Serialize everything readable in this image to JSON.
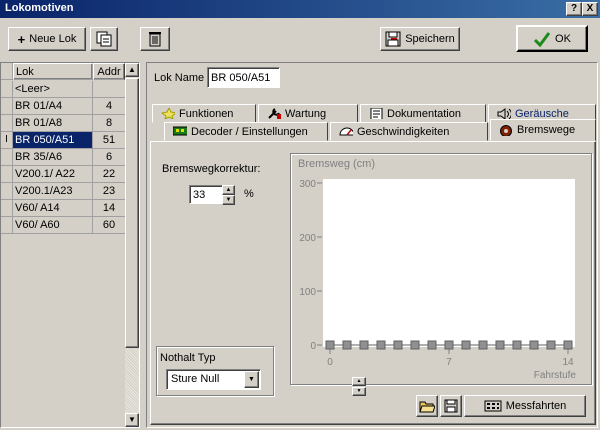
{
  "window": {
    "title": "Lokomotiven",
    "help_label": "?",
    "close_label": "X"
  },
  "toolbar": {
    "new_lok_label": "Neue Lok",
    "save_label": "Speichern",
    "ok_label": "OK"
  },
  "list": {
    "headers": [
      "Lok",
      "Addr"
    ],
    "rows": [
      {
        "name": "<Leer>",
        "addr": ""
      },
      {
        "name": "BR 01/A4",
        "addr": "4"
      },
      {
        "name": "BR 01/A8",
        "addr": "8"
      },
      {
        "name": "BR 050/A51",
        "addr": "51",
        "marker": "I"
      },
      {
        "name": "BR 35/A6",
        "addr": "6"
      },
      {
        "name": "V200.1/ A22",
        "addr": "22"
      },
      {
        "name": "V200.1/A23",
        "addr": "23"
      },
      {
        "name": "V60/ A14",
        "addr": "14"
      },
      {
        "name": "V60/ A60",
        "addr": "60"
      }
    ]
  },
  "lok_name": {
    "label": "Lok Name",
    "value": "BR 050/A51"
  },
  "tabs": {
    "row1": [
      "Funktionen",
      "Wartung",
      "Dokumentation",
      "Geräusche"
    ],
    "row2": [
      "Decoder / Einstellungen",
      "Geschwindigkeiten",
      "Bremswege"
    ],
    "active": "Bremswege"
  },
  "bremsweg": {
    "korrektur_label": "Bremswegkorrektur:",
    "korrektur_value": "33",
    "unit": "%",
    "nothalt_label": "Nothalt Typ",
    "nothalt_value": "Sture Null"
  },
  "chart_data": {
    "type": "line",
    "title": "Bremsweg (cm)",
    "xlabel": "Fahrstufe",
    "ylim": [
      0,
      300
    ],
    "yticks": [
      0,
      100,
      200,
      300
    ],
    "xticks": [
      0,
      7,
      14
    ],
    "x": [
      0,
      1,
      2,
      3,
      4,
      5,
      6,
      7,
      8,
      9,
      10,
      11,
      12,
      13,
      14
    ],
    "values": [
      0,
      0,
      0,
      0,
      0,
      0,
      0,
      0,
      0,
      0,
      0,
      0,
      0,
      0,
      0
    ],
    "grid": false
  },
  "bottom": {
    "messfahrten_label": "Messfahrten"
  },
  "colors": {
    "titlebar": "#0a246a",
    "selection": "#0a246a",
    "ok_check": "#1a8a1a",
    "tab_active_text": "#0a246a",
    "chart_bg": "#ffffff"
  }
}
